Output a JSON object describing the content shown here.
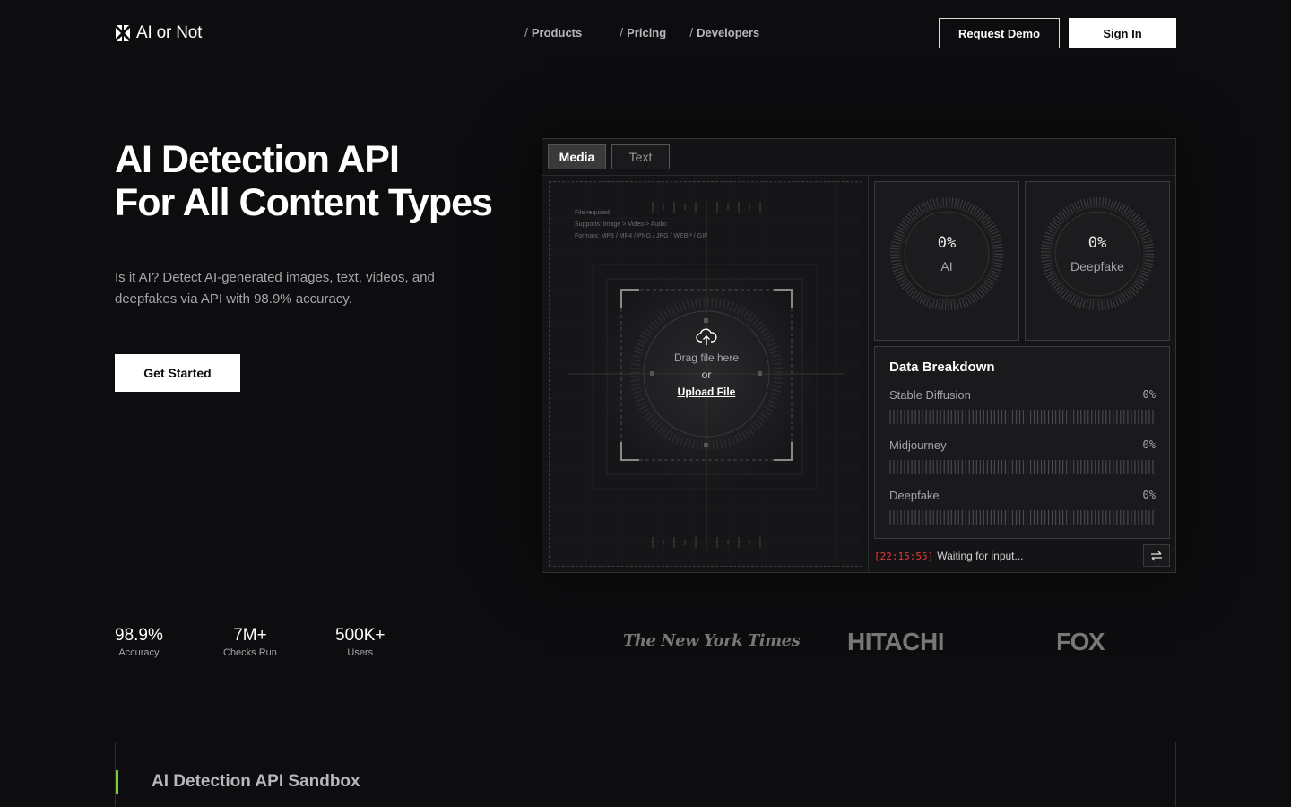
{
  "brand": {
    "name": "AI or Not"
  },
  "nav": {
    "links": [
      {
        "label": "Products"
      },
      {
        "label": "Pricing"
      },
      {
        "label": "Developers"
      }
    ],
    "request_demo": "Request Demo",
    "sign_in": "Sign In"
  },
  "hero": {
    "title_line1": "AI Detection API",
    "title_line2": "For All Content Types",
    "description": "Is it AI? Detect AI-generated images, text, videos, and deepfakes via API with 98.9% accuracy.",
    "cta": "Get Started"
  },
  "panel": {
    "tabs": [
      {
        "label": "Media",
        "active": true
      },
      {
        "label": "Text",
        "active": false
      }
    ],
    "dropzone": {
      "meta_required": "File required",
      "meta_supports": "Supports: Image > Video > Audio",
      "meta_formats": "Formats: MP3 / MP4 / PNG / JPG / WEBP / GIF",
      "drag_text": "Drag file here",
      "or_text": "or",
      "upload_text": "Upload File"
    },
    "gauges": [
      {
        "value": "0%",
        "label": "AI"
      },
      {
        "value": "0%",
        "label": "Deepfake"
      }
    ],
    "breakdown": {
      "title": "Data Breakdown",
      "rows": [
        {
          "name": "Stable Diffusion",
          "pct": "0%",
          "level": 0
        },
        {
          "name": "Midjourney",
          "pct": "0%",
          "level": 0
        },
        {
          "name": "Deepfake",
          "pct": "0%",
          "level": 0
        }
      ]
    },
    "status": {
      "time": "[22:15:55]",
      "text": "Waiting for input..."
    }
  },
  "stats": [
    {
      "value": "98.9%",
      "label": "Accuracy"
    },
    {
      "value": "7M+",
      "label": "Checks Run"
    },
    {
      "value": "500K+",
      "label": "Users"
    }
  ],
  "logos": {
    "nyt": "The New York Times",
    "hitachi": "HITACHI",
    "fox": "FOX"
  },
  "sandbox": {
    "title": "AI Detection API Sandbox"
  },
  "colors": {
    "background": "#0d0d0f",
    "accent_green": "#7ac943",
    "status_red": "#e53935"
  }
}
